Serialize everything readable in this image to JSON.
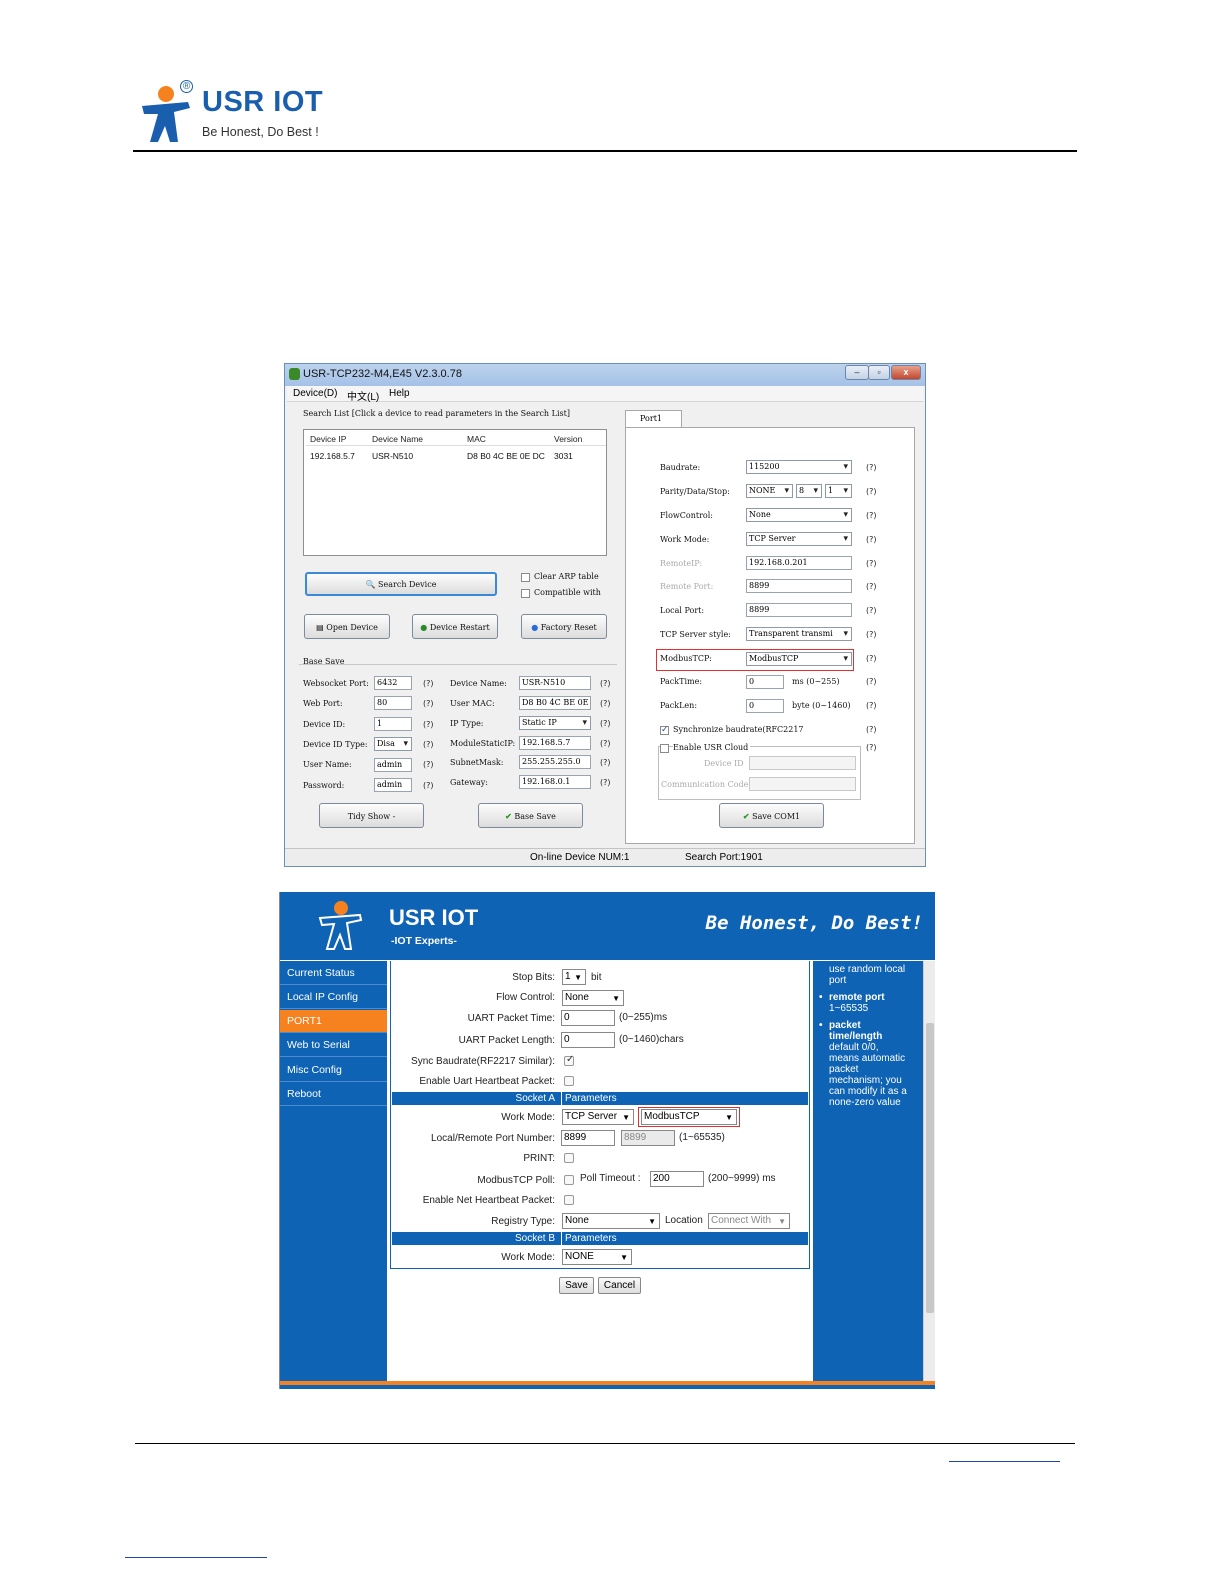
{
  "header": {
    "logo_reg": "®",
    "brand": "USR IOT",
    "tagline": "Be Honest, Do Best !"
  },
  "colors": {
    "brand_blue": "#1a5fae",
    "web_blue": "#0f63b5",
    "accent_orange": "#f5821f",
    "highlight_red": "#e03030"
  },
  "app": {
    "title": "USR-TCP232-M4,E45 V2.3.0.78",
    "title_buttons": [
      "–",
      "▫",
      "x"
    ],
    "menu": [
      "Device(D)",
      "中文(L)",
      "Help"
    ],
    "search_hint": "Search List [Click a device to read parameters in the Search List]",
    "list_headers": [
      "Device IP",
      "Device Name",
      "MAC",
      "Version"
    ],
    "list_row": [
      "192.168.5.7",
      "USR-N510",
      "D8 B0 4C BE 0E DC",
      "3031"
    ],
    "search_button": "Search Device",
    "clear_arp": "Clear ARP table",
    "compatible": "Compatible with",
    "open_device": "Open Device",
    "device_restart": "Device Restart",
    "factory_reset": "Factory Reset",
    "base_save_group": "Base Save",
    "base": {
      "websocket_port_label": "Websocket Port:",
      "websocket_port": "6432",
      "web_port_label": "Web Port:",
      "web_port": "80",
      "device_id_label": "Device ID:",
      "device_id": "1",
      "device_id_type_label": "Device ID Type:",
      "device_id_type": "Disa",
      "user_name_label": "User Name:",
      "user_name": "admin",
      "password_label": "Password:",
      "password": "admin",
      "device_name_label": "Device Name:",
      "device_name": "USR-N510",
      "user_mac_label": "User MAC:",
      "user_mac": "D8 B0 4C BE 0E",
      "ip_type_label": "IP      Type:",
      "ip_type": "Static IP",
      "module_ip_label": "ModuleStaticIP:",
      "module_ip": "192.168.5.7",
      "subnet_label": "SubnetMask:",
      "subnet": "255.255.255.0",
      "gateway_label": "Gateway:",
      "gateway": "192.168.0.1",
      "q": "(?)"
    },
    "tidy_show": "Tidy Show  -",
    "base_save": "Base Save",
    "port_tab": "Port1",
    "port": {
      "baudrate_label": "Baudrate:",
      "baudrate": "115200",
      "parity_label": "Parity/Data/Stop:",
      "parity": "NONE",
      "data": "8",
      "stop": "1",
      "flow_label": "FlowControl:",
      "flow": "None",
      "work_mode_label": "Work Mode:",
      "work_mode": "TCP Server",
      "remote_ip_label": "RemoteIP:",
      "remote_ip": "192.168.0.201",
      "remote_port_label": "Remote Port:",
      "remote_port": "8899",
      "local_port_label": "Local Port:",
      "local_port": "8899",
      "tcp_style_label": "TCP Server style:",
      "tcp_style": "Transparent transmi",
      "modbus_label": "ModbusTCP:",
      "modbus": "ModbusTCP",
      "packtime_label": "PackTime:",
      "packtime": "0",
      "packtime_unit": "ms  (0~255)",
      "packlen_label": "PackLen:",
      "packlen": "0",
      "packlen_unit": "byte  (0~1460)",
      "sync_baud": "Synchronize baudrate(RFC2217",
      "enable_cloud": "Enable USR Cloud",
      "cloud_device_id": "Device ID",
      "cloud_comm_code": "Communication Code",
      "save_com": "Save COM1",
      "q": "(?)"
    },
    "status_online": "On-line Device NUM:1",
    "status_port": "Search Port:1901"
  },
  "web": {
    "brand": "USR IOT",
    "sub": "-IOT Experts-",
    "slogan": "Be Honest, Do Best!",
    "nav": [
      "Current Status",
      "Local IP Config",
      "PORT1",
      "Web to Serial",
      "Misc Config",
      "Reboot"
    ],
    "stop_bits_label": "Stop Bits:",
    "stop_bits": "1",
    "stop_bits_unit": "bit",
    "flow_label": "Flow Control:",
    "flow": "None",
    "uart_time_label": "UART Packet Time:",
    "uart_time": "0",
    "uart_time_unit": "(0~255)ms",
    "uart_len_label": "UART Packet Length:",
    "uart_len": "0",
    "uart_len_unit": "(0~1460)chars",
    "sync_label": "Sync Baudrate(RF2217 Similar):",
    "heartbeat_label": "Enable Uart Heartbeat Packet:",
    "socket_a_left": "Socket A",
    "socket_a_right": "Parameters",
    "work_mode_label": "Work Mode:",
    "work_mode": "TCP Server",
    "modbus": "ModbusTCP",
    "port_label": "Local/Remote Port Number:",
    "local_port": "8899",
    "remote_port": "8899",
    "port_range": "(1~65535)",
    "print_label": "PRINT:",
    "modbus_poll_label": "ModbusTCP Poll:",
    "poll_timeout_label": "Poll Timeout :",
    "poll_timeout": "200",
    "poll_range": "(200~9999) ms",
    "net_heartbeat_label": "Enable Net Heartbeat Packet:",
    "registry_label": "Registry Type:",
    "registry": "None",
    "location_label": "Location",
    "location": "Connect With",
    "socket_b_left": "Socket B",
    "socket_b_right": "Parameters",
    "work_mode_b": "NONE",
    "save": "Save",
    "cancel": "Cancel",
    "help": [
      "use random local",
      "port",
      "remote port",
      "1~65535",
      "packet",
      "time/length",
      "default 0/0,",
      "means automatic",
      "packet",
      "mechanism; you",
      "can modify it as a",
      "none-zero value"
    ]
  }
}
